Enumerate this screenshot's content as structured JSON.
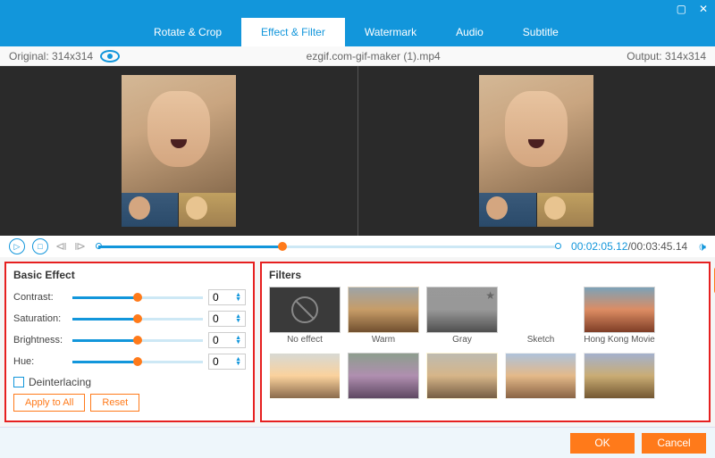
{
  "tabs": [
    "Rotate & Crop",
    "Effect & Filter",
    "Watermark",
    "Audio",
    "Subtitle"
  ],
  "active_tab": 1,
  "info": {
    "original": "Original: 314x314",
    "output": "Output: 314x314",
    "filename": "ezgif.com-gif-maker (1).mp4"
  },
  "time": {
    "current": "00:02:05.12",
    "total": "/00:03:45.14"
  },
  "basic": {
    "title": "Basic Effect",
    "params": [
      {
        "label": "Contrast:",
        "value": "0"
      },
      {
        "label": "Saturation:",
        "value": "0"
      },
      {
        "label": "Brightness:",
        "value": "0"
      },
      {
        "label": "Hue:",
        "value": "0"
      }
    ],
    "deinterlacing": "Deinterlacing",
    "apply": "Apply to All",
    "reset": "Reset"
  },
  "filters": {
    "title": "Filters",
    "items": [
      "No effect",
      "Warm",
      "Gray",
      "Sketch",
      "Hong Kong Movie",
      "",
      "",
      "",
      "",
      ""
    ]
  },
  "footer": {
    "ok": "OK",
    "cancel": "Cancel"
  }
}
